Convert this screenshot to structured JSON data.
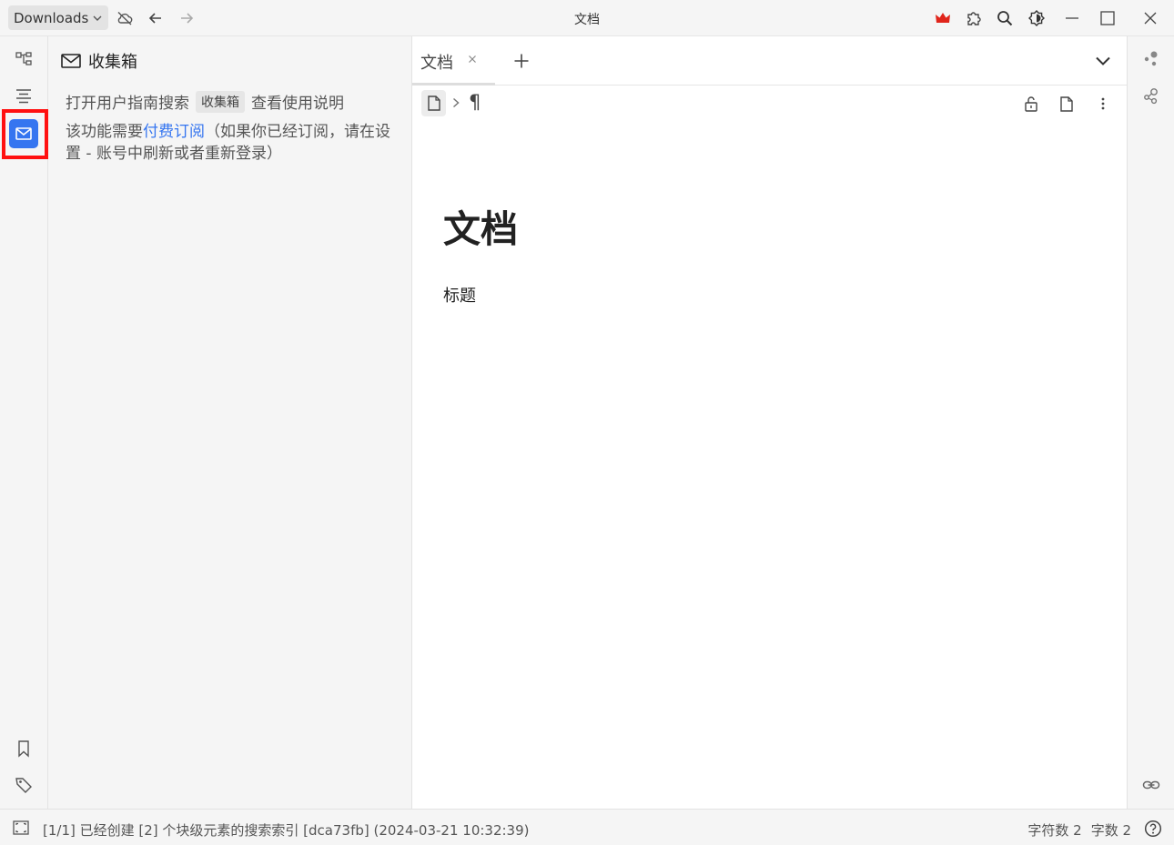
{
  "topbar": {
    "workspace": "Downloads",
    "window_title": "文档",
    "icons": [
      "cloud-off-icon",
      "back-arrow-icon",
      "forward-arrow-icon",
      "crown-icon",
      "plugin-icon",
      "search-icon",
      "theme-icon",
      "minimize-icon",
      "maximize-icon",
      "close-icon"
    ],
    "crown_color": "#e0251b"
  },
  "dock_left": {
    "top_icons": [
      "file-tree-icon",
      "outline-icon",
      "inbox-icon"
    ],
    "bottom_icons": [
      "bookmark-icon",
      "tag-icon"
    ],
    "active": "inbox-icon",
    "active_color": "#3575f0",
    "highlight_color": "#ff1010"
  },
  "inbox": {
    "title": "收集箱",
    "help_prefix": "打开用户指南搜索",
    "help_kbd": "收集箱",
    "help_suffix": "查看使用说明",
    "subscribe_prefix": "该功能需要",
    "subscribe_link": "付费订阅",
    "subscribe_suffix": "（如果你已经订阅，请在设置 - 账号中刷新或者重新登录）",
    "link_color": "#3575f0"
  },
  "editor": {
    "tab_label": "文档",
    "breadcrumb_icons": [
      "doc-icon",
      "chevron-right-icon",
      "paragraph-icon"
    ],
    "paragraph_symbol": "¶",
    "toolbar_icons": [
      "unlock-icon",
      "file-icon",
      "more-vertical-icon"
    ],
    "doc_title": "文档",
    "doc_body": "标题"
  },
  "dock_right": {
    "icons": [
      "graph-icon",
      "global-graph-icon",
      "backlink-icon"
    ]
  },
  "statusbar": {
    "message": "[1/1] 已经创建 [2] 个块级元素的搜索索引 [dca73fb] (2024-03-21 10:32:39)",
    "char_count": "字符数 2",
    "word_count": "字数 2"
  }
}
